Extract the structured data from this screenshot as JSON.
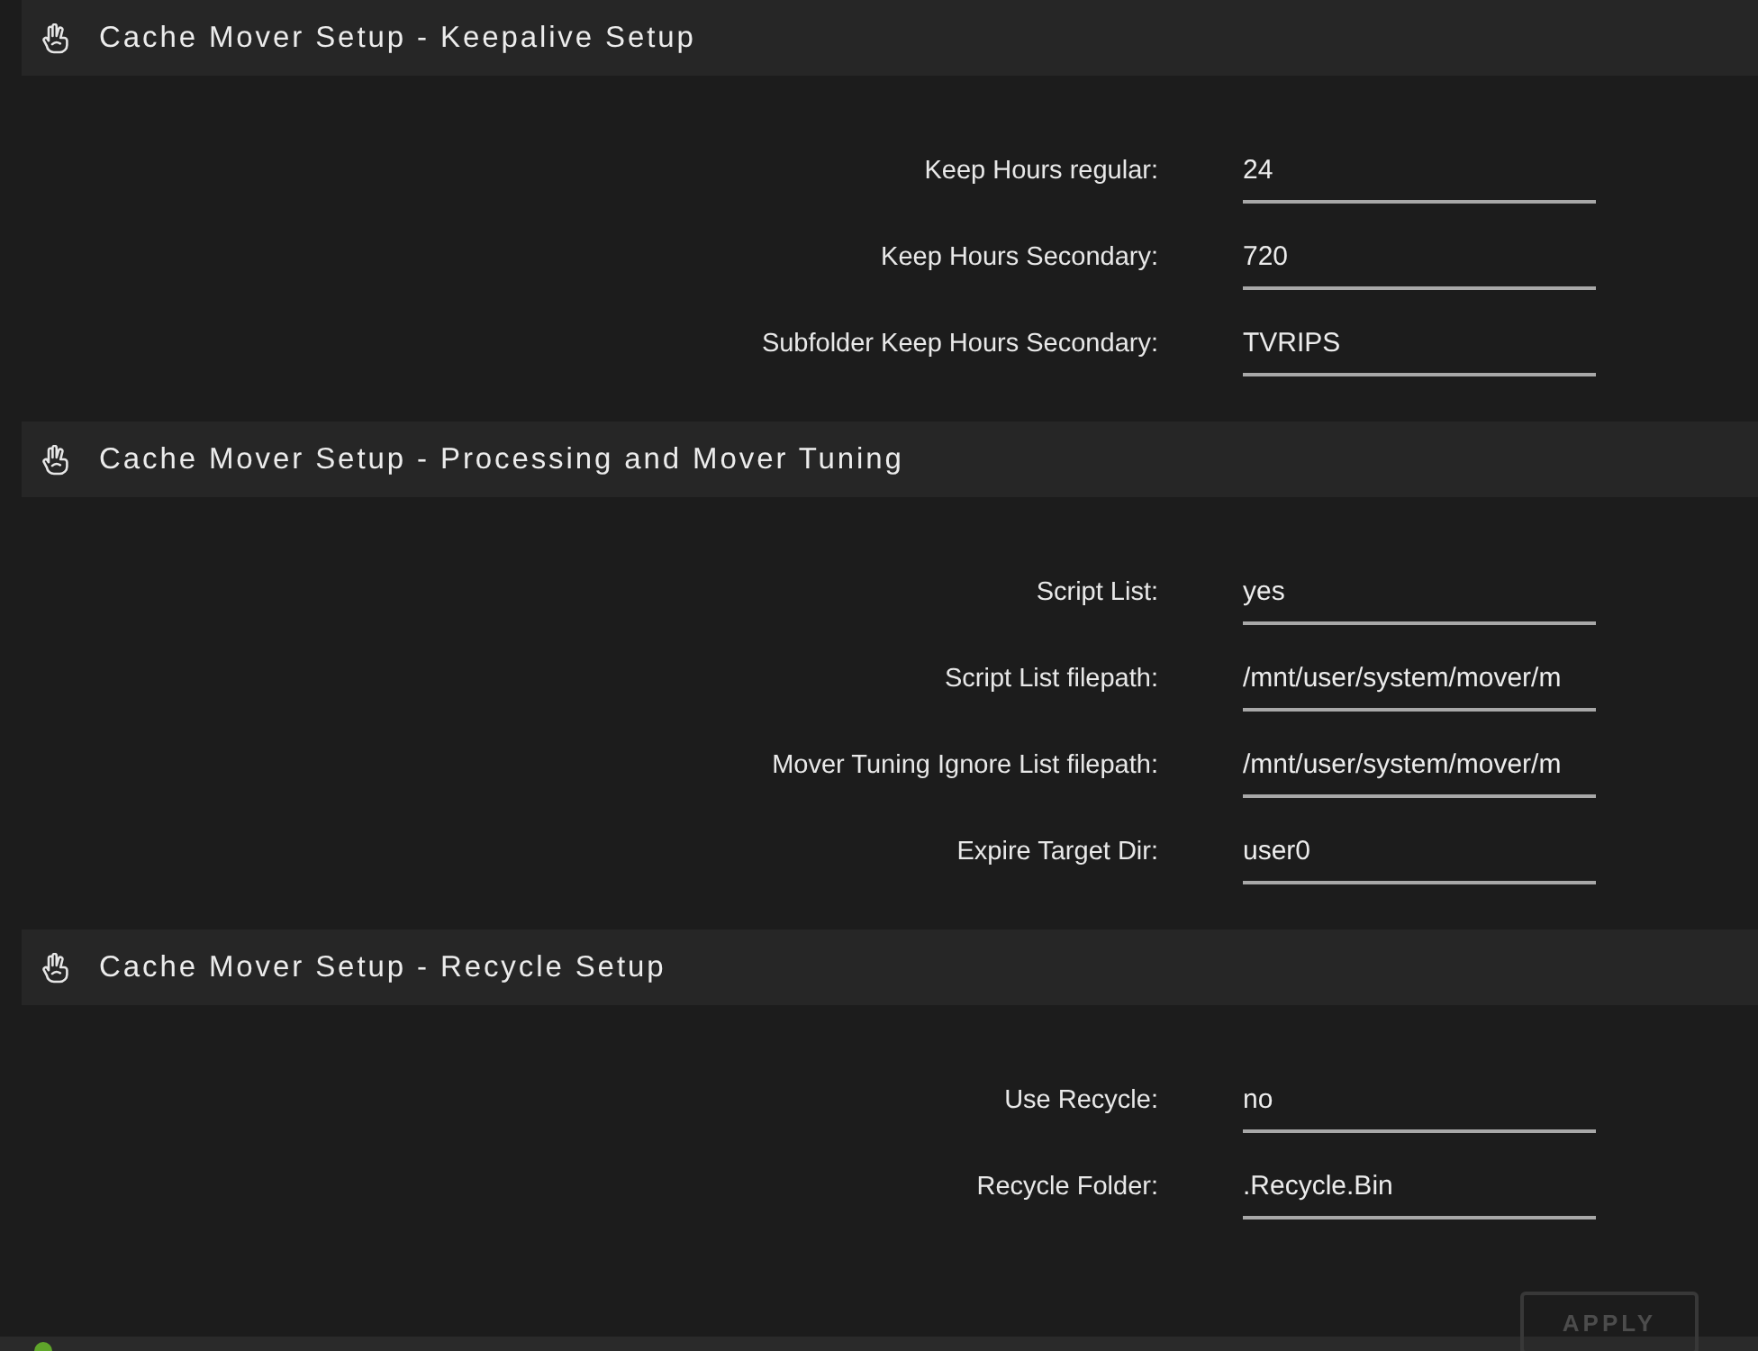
{
  "sections": [
    {
      "title": "Cache Mover Setup - Keepalive Setup",
      "fields": [
        {
          "label": "Keep Hours regular:",
          "value": "24"
        },
        {
          "label": "Keep Hours Secondary:",
          "value": "720"
        },
        {
          "label": "Subfolder Keep Hours Secondary:",
          "value": "TVRIPS"
        }
      ]
    },
    {
      "title": "Cache Mover Setup - Processing and Mover Tuning",
      "fields": [
        {
          "label": "Script List:",
          "value": "yes"
        },
        {
          "label": "Script List filepath:",
          "value": "/mnt/user/system/mover/m"
        },
        {
          "label": "Mover Tuning Ignore List filepath:",
          "value": "/mnt/user/system/mover/m"
        },
        {
          "label": "Expire Target Dir:",
          "value": "user0"
        }
      ]
    },
    {
      "title": "Cache Mover Setup - Recycle Setup",
      "fields": [
        {
          "label": "Use Recycle:",
          "value": "no"
        },
        {
          "label": "Recycle Folder:",
          "value": ".Recycle.Bin"
        }
      ]
    }
  ],
  "apply_button": {
    "label": "APPLY",
    "disabled": true
  }
}
